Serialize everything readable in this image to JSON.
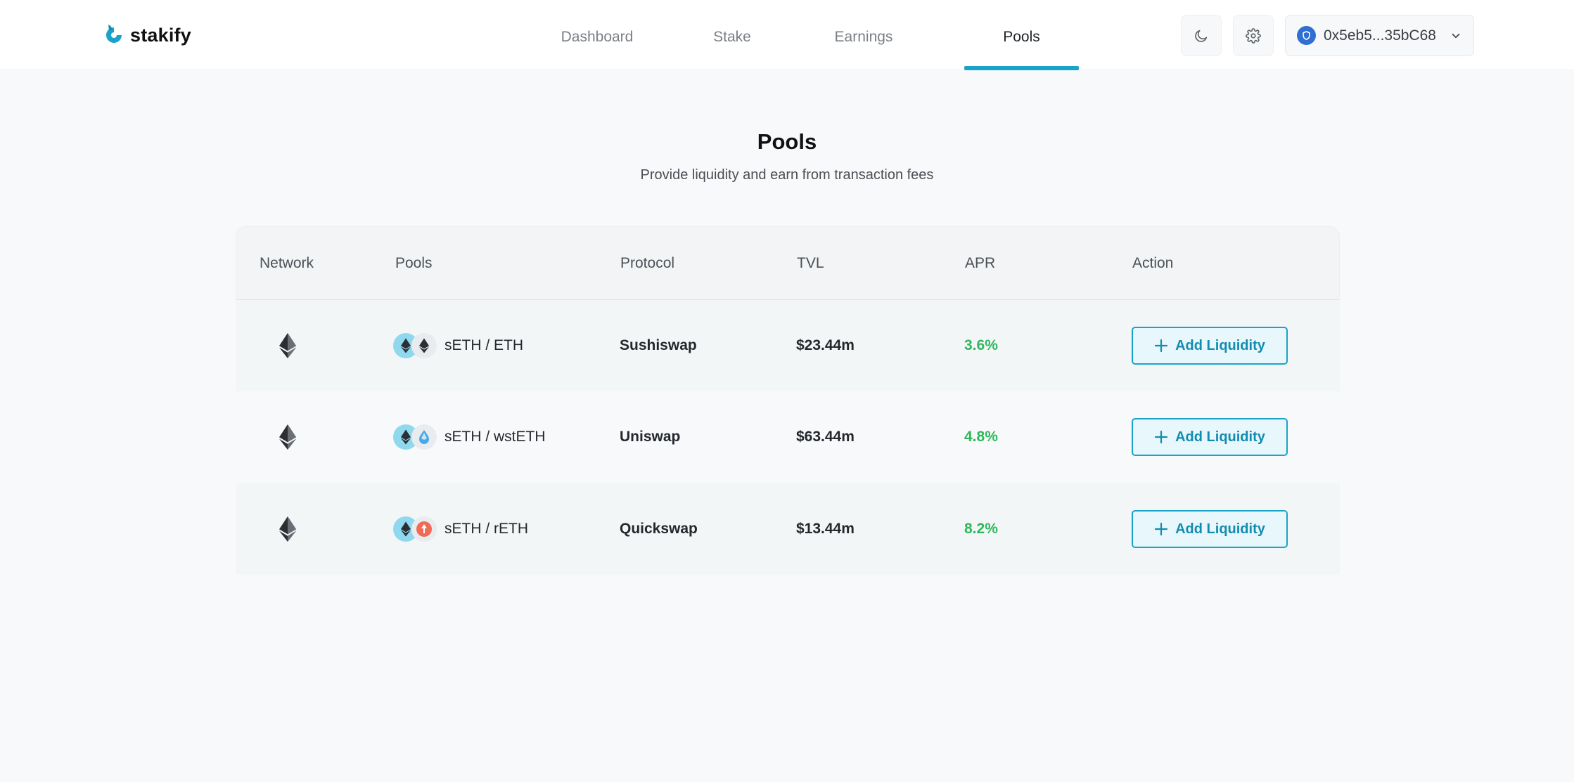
{
  "brand": {
    "name": "stakify",
    "accent": "#1aa3c9"
  },
  "nav": {
    "items": [
      {
        "label": "Dashboard",
        "active": false
      },
      {
        "label": "Stake",
        "active": false
      },
      {
        "label": "Earnings",
        "active": false
      },
      {
        "label": "Pools",
        "active": true
      }
    ]
  },
  "header": {
    "theme_icon": "moon-icon",
    "settings_icon": "gear-icon",
    "wallet": {
      "address": "0x5eb5...35bC68",
      "icon": "shield-icon"
    }
  },
  "page": {
    "title": "Pools",
    "subtitle": "Provide liquidity and earn from transaction fees"
  },
  "table": {
    "columns": [
      "Network",
      "Pools",
      "Protocol",
      "TVL",
      "APR",
      "Action"
    ],
    "rows": [
      {
        "network_icon": "ethereum-icon",
        "pool": "sETH / ETH",
        "token_b_icon": "eth-token-icon",
        "protocol": "Sushiswap",
        "tvl": "$23.44m",
        "apr": "3.6%",
        "action": "Add Liquidity"
      },
      {
        "network_icon": "ethereum-icon",
        "pool": "sETH / wstETH",
        "token_b_icon": "wsteth-token-icon",
        "protocol": "Uniswap",
        "tvl": "$63.44m",
        "apr": "4.8%",
        "action": "Add Liquidity"
      },
      {
        "network_icon": "ethereum-icon",
        "pool": "sETH / rETH",
        "token_b_icon": "reth-token-icon",
        "protocol": "Quickswap",
        "tvl": "$13.44m",
        "apr": "8.2%",
        "action": "Add Liquidity"
      }
    ]
  },
  "colors": {
    "apr": "#2fb85c",
    "button_border": "#1aa3c9",
    "button_bg": "#e7f7fb"
  }
}
